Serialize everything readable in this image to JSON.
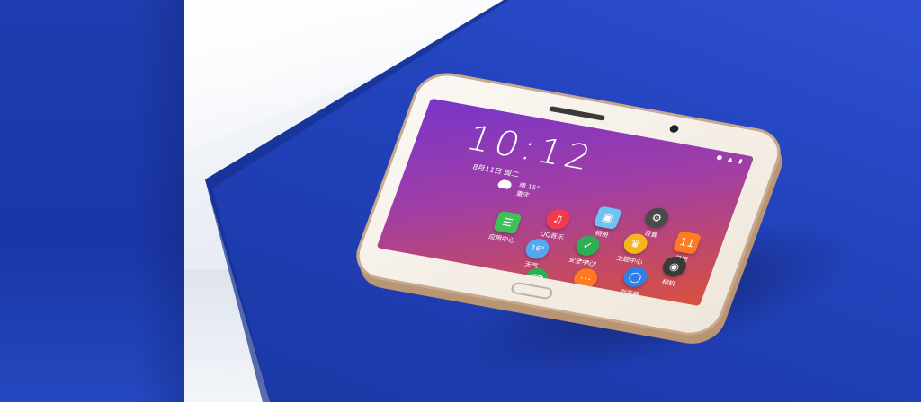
{
  "lockscreen": {
    "status": "● ▲ ▮",
    "time": "10:12",
    "date": "8月11日 周二",
    "temperature": "晴 15°",
    "city": "重庆"
  },
  "apps": {
    "settings": "设置",
    "photos": "相册",
    "calendar": "日历",
    "calendar_day": "11",
    "qq_music": "QQ音乐",
    "app_center": "应用中心",
    "theme_center": "主题中心",
    "security_center": "安全中心",
    "weather": "天气",
    "weather_temp": "16°",
    "browser": "浏览器",
    "camera": "相机",
    "phone": "电话",
    "messages": "短信"
  },
  "colors": {
    "backdrop_blue": "#2242bb",
    "phone_body": "#f4efe7",
    "phone_trim": "#c9a98a",
    "screen_top": "#7a35c9",
    "screen_bottom": "#d8513e"
  }
}
